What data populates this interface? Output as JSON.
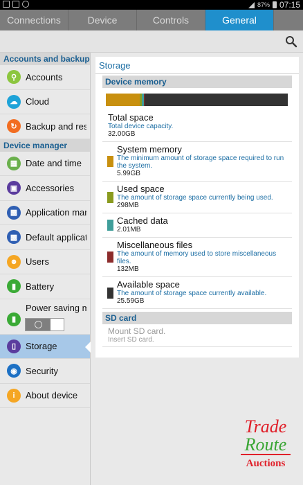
{
  "status": {
    "battery_pct": "87%",
    "time": "07:15"
  },
  "tabs": [
    {
      "label": "Connections"
    },
    {
      "label": "Device"
    },
    {
      "label": "Controls"
    },
    {
      "label": "General"
    }
  ],
  "sidebar": {
    "accounts_header": "Accounts and backup",
    "device_header": "Device manager",
    "items": [
      {
        "label": "Accounts",
        "icon": "key-icon",
        "color": "#8cc63f"
      },
      {
        "label": "Cloud",
        "icon": "cloud-icon",
        "color": "#1ea3d8"
      },
      {
        "label": "Backup and reset",
        "icon": "backup-icon",
        "color": "#f26d21"
      },
      {
        "label": "Date and time",
        "icon": "calendar-icon",
        "color": "#6ab04c"
      },
      {
        "label": "Accessories",
        "icon": "accessories-icon",
        "color": "#5b3c9e"
      },
      {
        "label": "Application manager",
        "icon": "apps-icon",
        "color": "#2f5fb3"
      },
      {
        "label": "Default applications",
        "icon": "default-apps-icon",
        "color": "#2f5fb3"
      },
      {
        "label": "Users",
        "icon": "users-icon",
        "color": "#f5a623"
      },
      {
        "label": "Battery",
        "icon": "battery-icon",
        "color": "#3aaa35"
      },
      {
        "label": "Power saving mode",
        "icon": "power-saving-icon",
        "color": "#3aaa35"
      },
      {
        "label": "Storage",
        "icon": "storage-icon",
        "color": "#5b3c9e"
      },
      {
        "label": "Security",
        "icon": "lock-icon",
        "color": "#1c70c4"
      },
      {
        "label": "About device",
        "icon": "info-icon",
        "color": "#f5a623"
      }
    ]
  },
  "storage": {
    "title": "Storage",
    "device_memory_header": "Device memory",
    "usage": [
      {
        "name": "System memory",
        "fraction": 0.187,
        "color": "#c8900f"
      },
      {
        "name": "Used space",
        "fraction": 0.009,
        "color": "#8a9b1f"
      },
      {
        "name": "Cached data",
        "fraction": 0.012,
        "color": "#3f9e9a"
      },
      {
        "name": "Miscellaneous files",
        "fraction": 0.006,
        "color": "#8c2c2c"
      },
      {
        "name": "Available space",
        "fraction": 0.786,
        "color": "#333333"
      }
    ],
    "total": {
      "title": "Total space",
      "subtitle": "Total device capacity.",
      "value": "32.00GB"
    },
    "rows": [
      {
        "title": "System memory",
        "subtitle": "The minimum amount of storage space required to run the system.",
        "value": "5.99GB",
        "color": "#c8900f"
      },
      {
        "title": "Used space",
        "subtitle": "The amount of storage space currently being used.",
        "value": "298MB",
        "color": "#8a9b1f"
      },
      {
        "title": "Cached data",
        "subtitle": "",
        "value": "2.01MB",
        "color": "#3f9e9a"
      },
      {
        "title": "Miscellaneous files",
        "subtitle": "The amount of memory used to store miscellaneous files.",
        "value": "132MB",
        "color": "#8c2c2c"
      },
      {
        "title": "Available space",
        "subtitle": "The amount of storage space currently available.",
        "value": "25.59GB",
        "color": "#333333"
      }
    ],
    "sd_header": "SD card",
    "sd_title": "Mount SD card.",
    "sd_subtitle": "Insert SD card."
  },
  "watermark": {
    "line1": "Trade",
    "line2": "Route",
    "line3": "Auctions"
  }
}
